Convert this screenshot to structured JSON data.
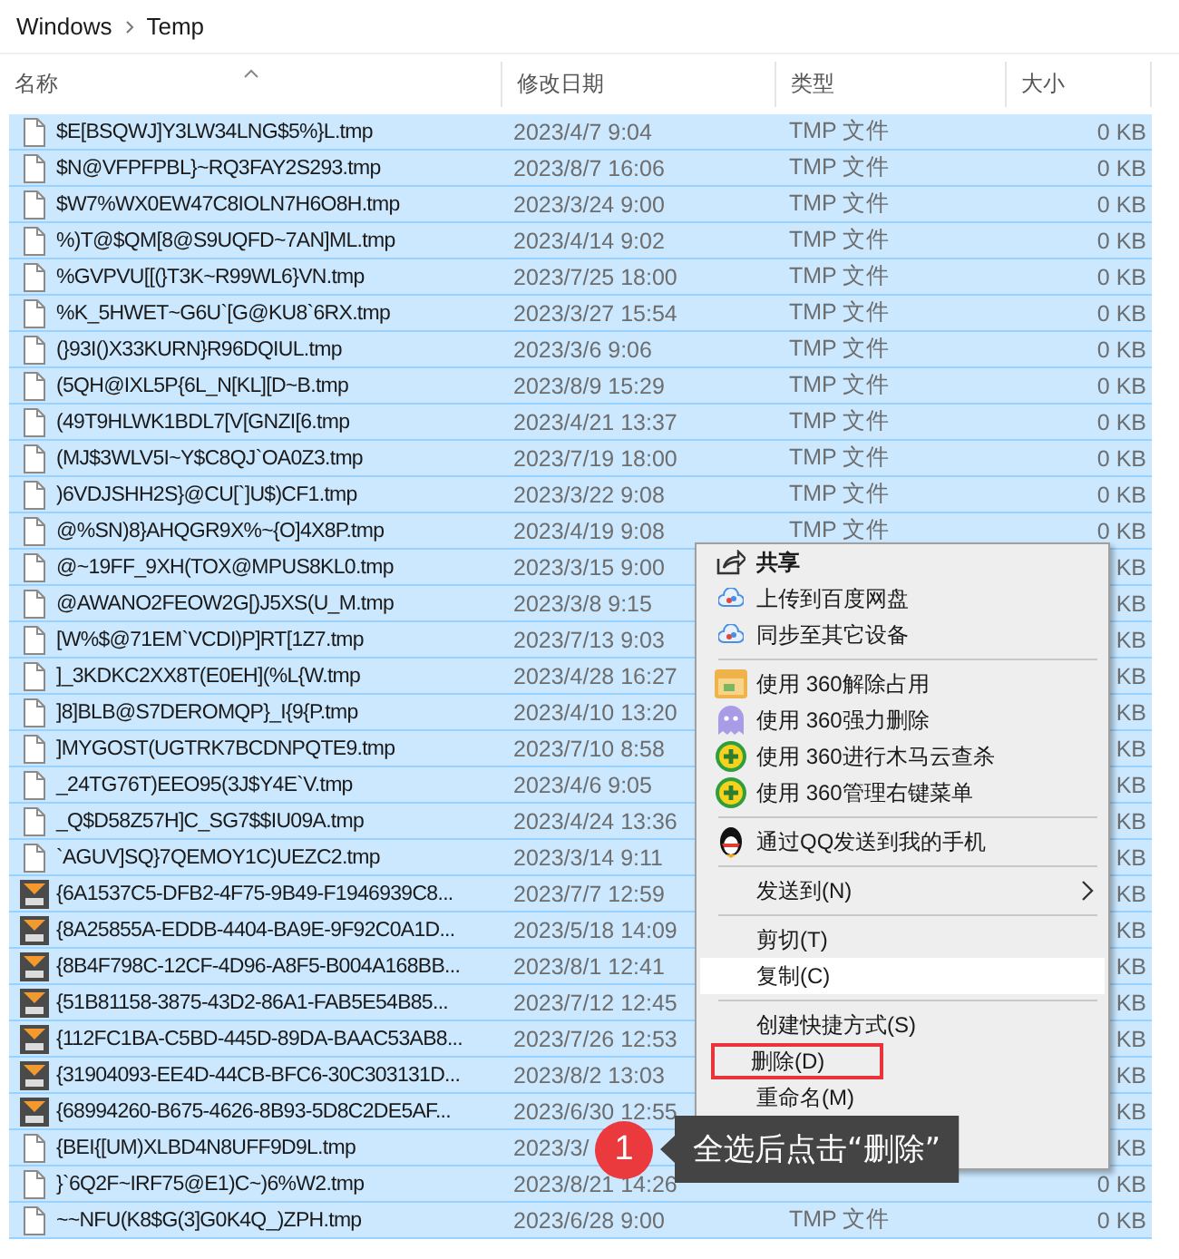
{
  "breadcrumb": [
    "Windows",
    "Temp"
  ],
  "columns": [
    "名称",
    "修改日期",
    "类型",
    "大小"
  ],
  "rows": [
    {
      "kind": "tmp",
      "name": "$E[BSQWJ]Y3LW34LNG$5%}L.tmp",
      "date": "2023/4/7 9:04",
      "type": "TMP 文件",
      "size": "0 KB",
      "selected": true
    },
    {
      "kind": "tmp",
      "name": "$N@VFPFPBL}~RQ3FAY2S293.tmp",
      "date": "2023/8/7 16:06",
      "type": "TMP 文件",
      "size": "0 KB",
      "selected": true
    },
    {
      "kind": "tmp",
      "name": "$W7%WX0EW47C8IOLN7H6O8H.tmp",
      "date": "2023/3/24 9:00",
      "type": "TMP 文件",
      "size": "0 KB",
      "selected": true
    },
    {
      "kind": "tmp",
      "name": "%)T@$QM[8@S9UQFD~7AN]ML.tmp",
      "date": "2023/4/14 9:02",
      "type": "TMP 文件",
      "size": "0 KB",
      "selected": true
    },
    {
      "kind": "tmp",
      "name": "%GVPVU[[(}T3K~R99WL6}VN.tmp",
      "date": "2023/7/25 18:00",
      "type": "TMP 文件",
      "size": "0 KB",
      "selected": true
    },
    {
      "kind": "tmp",
      "name": "%K_5HWET~G6U`[G@KU8`6RX.tmp",
      "date": "2023/3/27 15:54",
      "type": "TMP 文件",
      "size": "0 KB",
      "selected": true
    },
    {
      "kind": "tmp",
      "name": "(}93I()X33KURN}R96DQIUL.tmp",
      "date": "2023/3/6 9:06",
      "type": "TMP 文件",
      "size": "0 KB",
      "selected": true
    },
    {
      "kind": "tmp",
      "name": "(5QH@IXL5P{6L_N[KL][D~B.tmp",
      "date": "2023/8/9 15:29",
      "type": "TMP 文件",
      "size": "0 KB",
      "selected": true
    },
    {
      "kind": "tmp",
      "name": "(49T9HLWK1BDL7[V[GNZI[6.tmp",
      "date": "2023/4/21 13:37",
      "type": "TMP 文件",
      "size": "0 KB",
      "selected": true
    },
    {
      "kind": "tmp",
      "name": "(MJ$3WLV5I~Y$C8QJ`OA0Z3.tmp",
      "date": "2023/7/19 18:00",
      "type": "TMP 文件",
      "size": "0 KB",
      "selected": true
    },
    {
      "kind": "tmp",
      "name": ")6VDJSHH2S}@CU[`]U$)CF1.tmp",
      "date": "2023/3/22 9:08",
      "type": "TMP 文件",
      "size": "0 KB",
      "selected": true
    },
    {
      "kind": "tmp",
      "name": "@%SN)8}AHQGR9X%~{O]4X8P.tmp",
      "date": "2023/4/19 9:08",
      "type": "TMP 文件",
      "size": "0 KB",
      "selected": true
    },
    {
      "kind": "tmp",
      "name": "@~19FF_9XH(TOX@MPUS8KL0.tmp",
      "date": "2023/3/15 9:00",
      "size": "KB",
      "selected": true
    },
    {
      "kind": "tmp",
      "name": "@AWANO2FEOW2G[)J5XS(U_M.tmp",
      "date": "2023/3/8 9:15",
      "size": "KB",
      "selected": true
    },
    {
      "kind": "tmp",
      "name": "[W%$@71EM`VCDI)P]RT[1Z7.tmp",
      "date": "2023/7/13 9:03",
      "size": "KB",
      "selected": true
    },
    {
      "kind": "tmp",
      "name": "]_3KDKC2XX8T(E0EH](%L{W.tmp",
      "date": "2023/4/28 16:27",
      "size": "KB",
      "selected": true
    },
    {
      "kind": "tmp",
      "name": "]8]BLB@S7DEROMQP}_I{9{P.tmp",
      "date": "2023/4/10 13:20",
      "size": "KB",
      "selected": true
    },
    {
      "kind": "tmp",
      "name": "]MYGOST(UGTRK7BCDNPQTE9.tmp",
      "date": "2023/7/10 8:58",
      "size": "KB",
      "selected": true
    },
    {
      "kind": "tmp",
      "name": "_24TG76T)EEO95(3J$Y4E`V.tmp",
      "date": "2023/4/6 9:05",
      "size": "KB",
      "selected": true
    },
    {
      "kind": "tmp",
      "name": "_Q$D58Z57H]C_SG7$$IU09A.tmp",
      "date": "2023/4/24 13:36",
      "size": "KB",
      "selected": true
    },
    {
      "kind": "tmp",
      "name": "`AGUV]SQ}7QEMOY1C)UEZC2.tmp",
      "date": "2023/3/14 9:11",
      "size": "KB",
      "selected": true
    },
    {
      "kind": "dbt",
      "name": "{6A1537C5-DFB2-4F75-9B49-F1946939C8...",
      "date": "2023/7/7 12:59",
      "size": "KB",
      "selected": true
    },
    {
      "kind": "dbt",
      "name": "{8A25855A-EDDB-4404-BA9E-9F92C0A1D...",
      "date": "2023/5/18 14:09",
      "size": "KB",
      "selected": true
    },
    {
      "kind": "dbt",
      "name": "{8B4F798C-12CF-4D96-A8F5-B004A168BB...",
      "date": "2023/8/1 12:41",
      "size": "KB",
      "selected": true
    },
    {
      "kind": "dbt",
      "name": "{51B81158-3875-43D2-86A1-FAB5E54B85...",
      "date": "2023/7/12 12:45",
      "size": "KB",
      "selected": true
    },
    {
      "kind": "dbt",
      "name": "{112FC1BA-C5BD-445D-89DA-BAAC53AB8...",
      "date": "2023/7/26 12:53",
      "size": "KB",
      "selected": true
    },
    {
      "kind": "dbt",
      "name": "{31904093-EE4D-44CB-BFC6-30C303131D...",
      "date": "2023/8/2 13:03",
      "size": "KB",
      "selected": true
    },
    {
      "kind": "dbt",
      "name": "{68994260-B675-4626-8B93-5D8C2DE5AF...",
      "date": "2023/6/30 12:55",
      "size": "KB",
      "selected": true
    },
    {
      "kind": "tmp",
      "name": "{BEI{[UM)XLBD4N8UFF9D9L.tmp",
      "date": "2023/3/",
      "size": "KB",
      "selected": true
    },
    {
      "kind": "tmp",
      "name": "}`6Q2F~IRF75@E1)C~)6%W2.tmp",
      "date": "2023/8/21 14:26",
      "size": "0 KB",
      "selected": true
    },
    {
      "kind": "tmp",
      "name": "~~NFU(K8$G(3]G0K4Q_)ZPH.tmp",
      "date": "2023/6/28 9:00",
      "type": "TMP 文件",
      "size": "0 KB",
      "selected": true
    }
  ],
  "context_menu": {
    "groups": [
      {
        "items": [
          {
            "kind": "share",
            "label": "共享",
            "highlighted": false,
            "boxed": false
          },
          {
            "kind": "cloud",
            "label": "上传到百度网盘",
            "highlighted": false,
            "boxed": false
          },
          {
            "kind": "cloud",
            "label": "同步至其它设备",
            "highlighted": false,
            "boxed": false
          }
        ]
      },
      {
        "items": [
          {
            "kind": "unlock",
            "label": "使用 360解除占用",
            "highlighted": false,
            "boxed": false
          },
          {
            "kind": "ghost",
            "label": "使用 360强力删除",
            "highlighted": false,
            "boxed": false
          },
          {
            "kind": "plus",
            "label": "使用 360进行木马云查杀",
            "highlighted": false,
            "boxed": false
          },
          {
            "kind": "plus",
            "label": "使用 360管理右键菜单",
            "highlighted": false,
            "boxed": false
          }
        ]
      },
      {
        "items": [
          {
            "kind": "penguin",
            "label": "通过QQ发送到我的手机",
            "highlighted": false,
            "boxed": false
          }
        ]
      },
      {
        "items": [
          {
            "kind": "submenu",
            "label": "发送到(N)",
            "highlighted": false,
            "boxed": false
          }
        ]
      },
      {
        "items": [
          {
            "kind": "plain",
            "label": "剪切(T)",
            "highlighted": false,
            "boxed": false
          },
          {
            "kind": "plain",
            "label": "复制(C)",
            "highlighted": true,
            "boxed": false
          }
        ]
      },
      {
        "items": [
          {
            "kind": "plain",
            "label": "创建快捷方式(S)",
            "highlighted": false,
            "boxed": false
          },
          {
            "kind": "plain",
            "label": "删除(D)",
            "highlighted": false,
            "boxed": true
          },
          {
            "kind": "plain",
            "label": "重命名(M)",
            "highlighted": false,
            "boxed": false
          }
        ]
      }
    ]
  },
  "callout": {
    "step": "1",
    "text": "全选后点击“删除”"
  }
}
